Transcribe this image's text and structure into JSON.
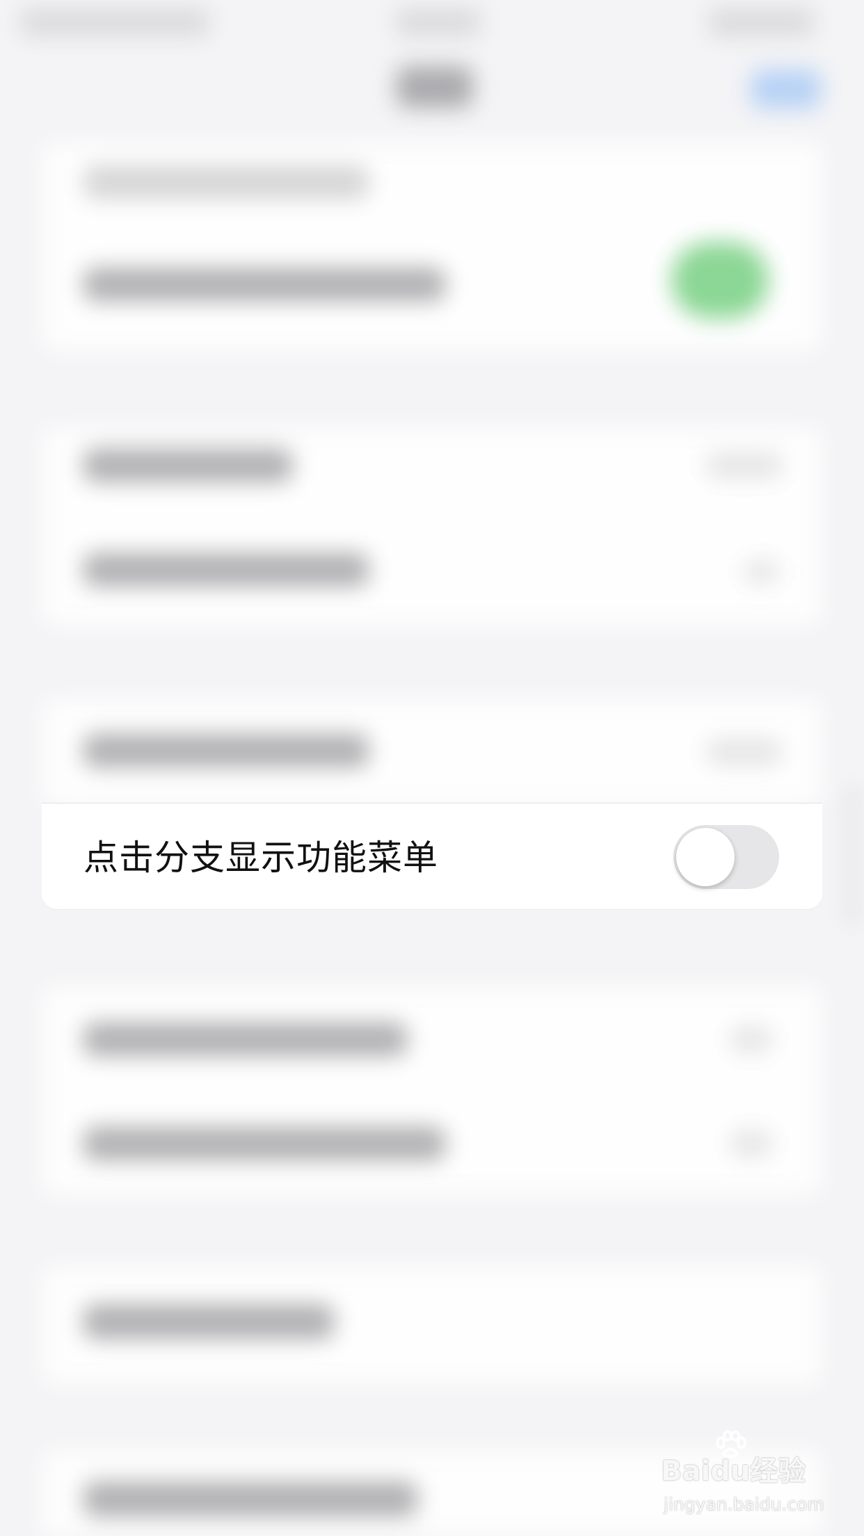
{
  "settings_item": {
    "label": "点击分支显示功能菜单",
    "toggle_on": false
  },
  "watermark": {
    "brand": "Baidu经验",
    "url": "jingyan.baidu.com"
  },
  "colors": {
    "background": "#f4f4f6",
    "card": "#ffffff",
    "toggle_off": "#e6e6e8",
    "toggle_on_blurred": "#7fd38a",
    "nav_button_blurred": "#a8c9f5"
  }
}
